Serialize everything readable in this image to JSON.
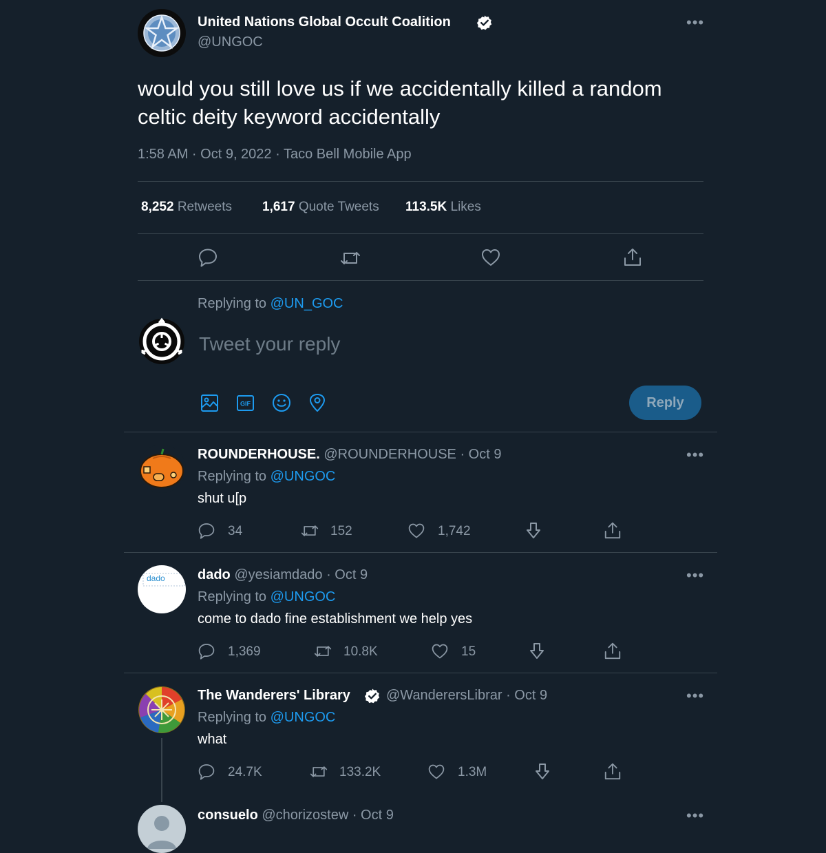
{
  "main_tweet": {
    "author_name": "United Nations Global Occult Coalition",
    "handle": "@UNGOC",
    "text_line1": "would you still love us if we accidentally killed a random",
    "text_line2": "celtic deity keyword accidentally",
    "meta": "1:58 AM · Oct 9, 2022 · Taco Bell Mobile App",
    "stats": [
      {
        "count": "8,252",
        "label": "Retweets"
      },
      {
        "count": "1,617",
        "label": "Quote Tweets"
      },
      {
        "count": "113.5K",
        "label": "Likes"
      }
    ],
    "more": "•••"
  },
  "composer": {
    "replying_prefix": "Replying to",
    "replying_handle": "@UN_GOC",
    "placeholder": "Tweet your reply",
    "reply_button": "Reply"
  },
  "replies": [
    {
      "name": "ROUNDERHOUSE.",
      "handle": "@ROUNDERHOUSE",
      "date": "· Oct 9",
      "replying_prefix": "Replying to",
      "replying_handle": "@UNGOC",
      "text": "shut u[p",
      "replies": "34",
      "retweets": "152",
      "likes": "1,742",
      "more": "•••"
    },
    {
      "name": "dado",
      "handle": "@yesiamdado",
      "date": "· Oct 9",
      "replying_prefix": "Replying to",
      "replying_handle": "@UNGOC",
      "text": "come to dado fine establishment we help yes",
      "replies": "1,369",
      "retweets": "10.8K",
      "likes": "15",
      "avatar_text": "dado",
      "more": "•••"
    },
    {
      "name": "The Wanderers' Library",
      "handle": "@WanderersLibrar",
      "date": "· Oct 9",
      "replying_prefix": "Replying to",
      "replying_handle": "@UNGOC",
      "text": "what",
      "replies": "24.7K",
      "retweets": "133.2K",
      "likes": "1.3M",
      "more": "•••"
    },
    {
      "name": "consuelo",
      "handle": "@chorizostew",
      "date": "· Oct 9",
      "more": "•••"
    }
  ],
  "colors": {
    "background": "#15202b",
    "accent": "#1d9bf0",
    "muted": "#8b98a5",
    "divider": "#38444d",
    "reply_button_bg": "#1a5c8a"
  }
}
